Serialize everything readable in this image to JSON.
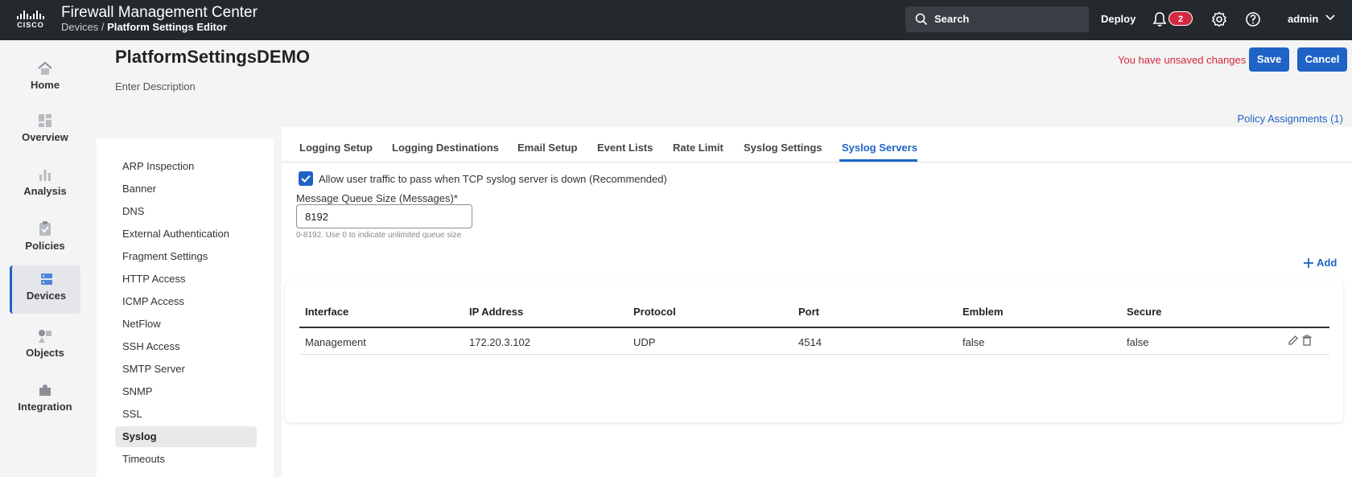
{
  "header": {
    "logo_text": "CISCO",
    "app_title": "Firewall Management Center",
    "breadcrumb_parent": "Devices /",
    "breadcrumb_current": "Platform Settings Editor",
    "search_label": "Search",
    "deploy_label": "Deploy",
    "notification_count": "2",
    "user_label": "admin"
  },
  "nav": {
    "items": [
      {
        "label": "Home",
        "icon": "home-icon"
      },
      {
        "label": "Overview",
        "icon": "dashboard-icon"
      },
      {
        "label": "Analysis",
        "icon": "bar-chart-icon"
      },
      {
        "label": "Policies",
        "icon": "clipboard-icon"
      },
      {
        "label": "Devices",
        "icon": "server-icon",
        "active": true
      },
      {
        "label": "Objects",
        "icon": "objects-icon"
      },
      {
        "label": "Integration",
        "icon": "puzzle-icon"
      }
    ]
  },
  "page": {
    "title": "PlatformSettingsDEMO",
    "description": "Enter Description",
    "unsaved_text": "You have unsaved changes",
    "save_label": "Save",
    "cancel_label": "Cancel",
    "policy_assignments": "Policy Assignments (1)"
  },
  "settings_list": [
    "ARP Inspection",
    "Banner",
    "DNS",
    "External Authentication",
    "Fragment Settings",
    "HTTP Access",
    "ICMP Access",
    "NetFlow",
    "SSH Access",
    "SMTP Server",
    "SNMP",
    "SSL",
    "Syslog",
    "Timeouts"
  ],
  "settings_active": "Syslog",
  "tabs": [
    "Logging Setup",
    "Logging Destinations",
    "Email Setup",
    "Event Lists",
    "Rate Limit",
    "Syslog Settings",
    "Syslog Servers"
  ],
  "tab_active": "Syslog Servers",
  "form": {
    "checkbox_label": "Allow user traffic to pass when TCP syslog server is down (Recommended)",
    "checkbox_checked": true,
    "queue_label": "Message Queue Size (Messages)*",
    "queue_value": "8192",
    "queue_help": "0-8192. Use 0 to indicate unlimited queue size",
    "add_label": "Add"
  },
  "table": {
    "columns": [
      "Interface",
      "IP Address",
      "Protocol",
      "Port",
      "Emblem",
      "Secure"
    ],
    "rows": [
      [
        "Management",
        "172.20.3.102",
        "UDP",
        "4514",
        "false",
        "false"
      ]
    ]
  },
  "colors": {
    "accent": "#1f63c6",
    "topbar": "#24292e",
    "danger": "#d4283e"
  }
}
